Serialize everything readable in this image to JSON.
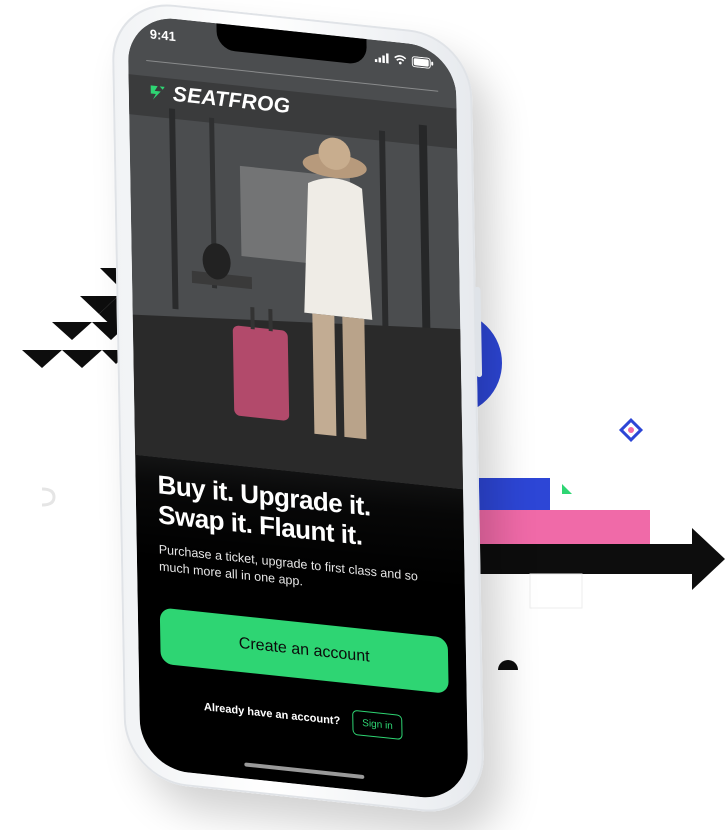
{
  "status_bar": {
    "time": "9:41"
  },
  "brand": {
    "name": "SEATFROG",
    "logo_icon": "seatfrog-logo-icon",
    "accent_color": "#2ed573"
  },
  "hero": {
    "headline_line1": "Buy it. Upgrade it.",
    "headline_line2": "Swap it. Flaunt it.",
    "subtitle": "Purchase a ticket, upgrade to first class and so much more all in one app."
  },
  "actions": {
    "create_account_label": "Create an account",
    "already_have_account": "Already have an account?",
    "sign_in_label": "Sign in"
  },
  "decor_colors": {
    "blue": "#2d46d6",
    "pink": "#f06aa8",
    "black": "#0d0d0d",
    "green": "#2ed573"
  }
}
